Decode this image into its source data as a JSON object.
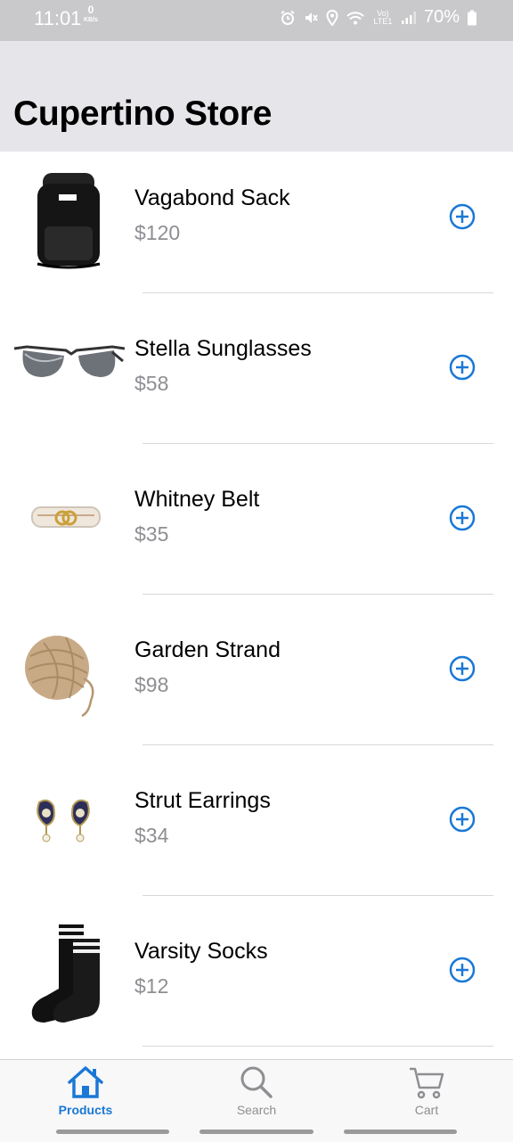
{
  "status_bar": {
    "time": "11:01",
    "net_speed": "0",
    "net_unit": "KB/s",
    "signal_label": "Vo) LTE1",
    "battery": "70%"
  },
  "header": {
    "title": "Cupertino Store"
  },
  "products": [
    {
      "name": "Vagabond Sack",
      "price": "$120",
      "image_icon": "backpack-icon"
    },
    {
      "name": "Stella Sunglasses",
      "price": "$58",
      "image_icon": "sunglasses-icon"
    },
    {
      "name": "Whitney Belt",
      "price": "$35",
      "image_icon": "belt-icon"
    },
    {
      "name": "Garden Strand",
      "price": "$98",
      "image_icon": "twine-ball-icon"
    },
    {
      "name": "Strut Earrings",
      "price": "$34",
      "image_icon": "earrings-icon"
    },
    {
      "name": "Varsity Socks",
      "price": "$12",
      "image_icon": "socks-icon"
    }
  ],
  "tabs": [
    {
      "label": "Products",
      "icon": "home-icon",
      "active": true
    },
    {
      "label": "Search",
      "icon": "search-icon",
      "active": false
    },
    {
      "label": "Cart",
      "icon": "cart-icon",
      "active": false
    }
  ],
  "colors": {
    "accent": "#1a78d6",
    "price_gray": "#8e8e93",
    "header_bg": "#e5e5ea",
    "status_bg": "#c9c9cb"
  }
}
